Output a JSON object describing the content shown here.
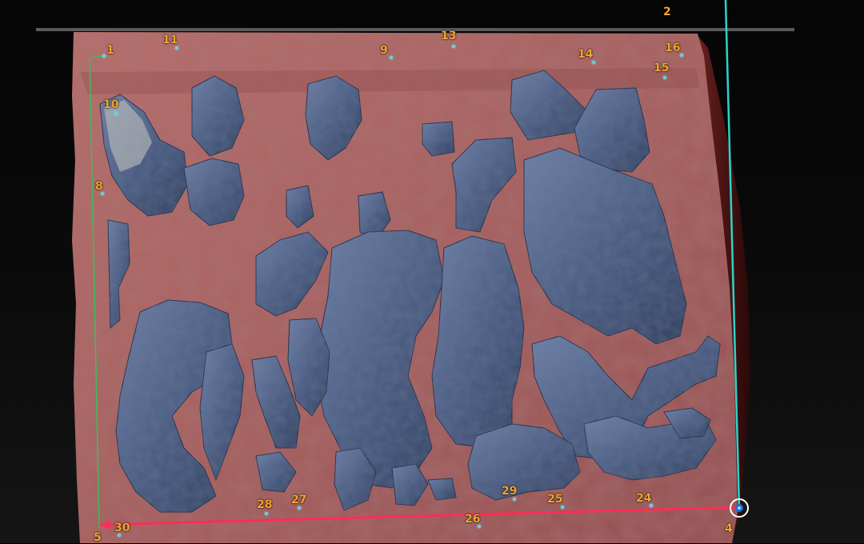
{
  "viewer": {
    "background_color": "#000000",
    "surface_color": "#a35a5a",
    "relief_color": "#46597e",
    "guide_line_color": "#ff2d55",
    "axis_line_color": "#2ad4c9",
    "left_guide_color": "#3bbf5a",
    "marker_label_color": "#f2a531",
    "marker_dot_color": "#5fd3e6"
  },
  "markers": [
    {
      "id": "m1",
      "label": "1"
    },
    {
      "id": "m2",
      "label": "2"
    },
    {
      "id": "m4",
      "label": "4"
    },
    {
      "id": "m5",
      "label": "5"
    },
    {
      "id": "m8",
      "label": "8"
    },
    {
      "id": "m9",
      "label": "9"
    },
    {
      "id": "m10",
      "label": "10"
    },
    {
      "id": "m11",
      "label": "11"
    },
    {
      "id": "m13",
      "label": "13"
    },
    {
      "id": "m14",
      "label": "14"
    },
    {
      "id": "m15",
      "label": "15"
    },
    {
      "id": "m16",
      "label": "16"
    },
    {
      "id": "m24",
      "label": "24"
    },
    {
      "id": "m25",
      "label": "25"
    },
    {
      "id": "m26",
      "label": "26"
    },
    {
      "id": "m27",
      "label": "27"
    },
    {
      "id": "m28",
      "label": "28"
    },
    {
      "id": "m29",
      "label": "29"
    },
    {
      "id": "m30",
      "label": "30"
    }
  ]
}
